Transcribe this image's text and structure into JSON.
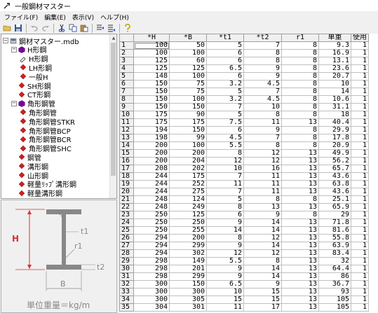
{
  "window": {
    "title": "一般鋼材マスター"
  },
  "menu": [
    "ファイル(F)",
    "編集(E)",
    "表示(V)",
    "ヘルプ(H)"
  ],
  "toolbar_icons": [
    "open-icon",
    "save-icon",
    "undo-icon",
    "redo-icon",
    "cut-icon",
    "copy-icon",
    "paste-icon",
    "insert-row-icon",
    "append-row-icon",
    "help-icon"
  ],
  "tree": {
    "root": "鋼材マスター.mdb",
    "nodes": [
      {
        "label": "H形鋼",
        "level": 1,
        "expander": "minus",
        "icon": "purple-hex"
      },
      {
        "label": "H形鋼",
        "level": 2,
        "expander": "",
        "icon": "open-pencil"
      },
      {
        "label": "LH形鋼",
        "level": 2,
        "expander": "",
        "icon": "red-diamond"
      },
      {
        "label": "一般H",
        "level": 2,
        "expander": "",
        "icon": "red-diamond"
      },
      {
        "label": "SH形鋼",
        "level": 1,
        "expander": "",
        "icon": "red-diamond"
      },
      {
        "label": "CT形鋼",
        "level": 1,
        "expander": "",
        "icon": "red-diamond"
      },
      {
        "label": "角形鋼管",
        "level": 1,
        "expander": "minus",
        "icon": "purple-hex"
      },
      {
        "label": "角形鋼管",
        "level": 2,
        "expander": "",
        "icon": "red-diamond"
      },
      {
        "label": "角形鋼管STKR",
        "level": 2,
        "expander": "",
        "icon": "red-diamond"
      },
      {
        "label": "角形鋼管BCP",
        "level": 2,
        "expander": "",
        "icon": "red-diamond"
      },
      {
        "label": "角形鋼管BCR",
        "level": 2,
        "expander": "",
        "icon": "red-diamond"
      },
      {
        "label": "角形鋼管SHC",
        "level": 2,
        "expander": "",
        "icon": "red-diamond"
      },
      {
        "label": "鋼管",
        "level": 1,
        "expander": "",
        "icon": "red-diamond"
      },
      {
        "label": "溝形鋼",
        "level": 1,
        "expander": "",
        "icon": "red-diamond"
      },
      {
        "label": "山形鋼",
        "level": 1,
        "expander": "",
        "icon": "red-diamond"
      },
      {
        "label": "軽量ﾘｯﾌﾟ溝形鋼",
        "level": 1,
        "expander": "",
        "icon": "red-diamond"
      },
      {
        "label": "軽量溝形鋼",
        "level": 1,
        "expander": "",
        "icon": "red-diamond"
      },
      {
        "label": "平鋼",
        "level": 1,
        "expander": "",
        "icon": "red-diamond"
      }
    ]
  },
  "diagram": {
    "H": "H",
    "B": "B",
    "t1": "t1",
    "t2": "t2",
    "r1": "r1",
    "caption": "単位重量＝kg/m"
  },
  "colors": {
    "dim_red": "#e03030",
    "section_gray": "#888888",
    "hex_purple": "#8000a0",
    "diamond_red": "#cc2020"
  },
  "grid": {
    "columns": [
      "",
      "*H",
      "*B",
      "*t1",
      "*t2",
      "r1",
      "単重",
      "使用"
    ],
    "rows": [
      [
        "1",
        "100",
        "50",
        "5",
        "7",
        "8",
        "9.3",
        "1"
      ],
      [
        "2",
        "100",
        "100",
        "6",
        "8",
        "8",
        "16.9",
        "1"
      ],
      [
        "3",
        "125",
        "60",
        "6",
        "8",
        "8",
        "13.1",
        "1"
      ],
      [
        "4",
        "125",
        "125",
        "6.5",
        "9",
        "8",
        "23.6",
        "1"
      ],
      [
        "5",
        "148",
        "100",
        "6",
        "9",
        "8",
        "20.7",
        "1"
      ],
      [
        "6",
        "150",
        "75",
        "3.2",
        "4.5",
        "8",
        "10",
        "1"
      ],
      [
        "7",
        "150",
        "75",
        "5",
        "7",
        "8",
        "14",
        "1"
      ],
      [
        "8",
        "150",
        "100",
        "3.2",
        "4.5",
        "8",
        "10.6",
        "1"
      ],
      [
        "9",
        "150",
        "150",
        "7",
        "10",
        "8",
        "31.1",
        "1"
      ],
      [
        "10",
        "175",
        "90",
        "5",
        "8",
        "8",
        "18",
        "1"
      ],
      [
        "11",
        "175",
        "175",
        "7.5",
        "11",
        "13",
        "40.4",
        "1"
      ],
      [
        "12",
        "194",
        "150",
        "6",
        "9",
        "8",
        "29.9",
        "1"
      ],
      [
        "13",
        "198",
        "99",
        "4.5",
        "7",
        "8",
        "17.8",
        "1"
      ],
      [
        "14",
        "200",
        "100",
        "5.5",
        "8",
        "8",
        "20.9",
        "1"
      ],
      [
        "15",
        "200",
        "200",
        "8",
        "12",
        "13",
        "49.9",
        "1"
      ],
      [
        "16",
        "200",
        "204",
        "12",
        "12",
        "13",
        "56.2",
        "1"
      ],
      [
        "17",
        "208",
        "202",
        "10",
        "16",
        "13",
        "65.7",
        "1"
      ],
      [
        "18",
        "244",
        "175",
        "7",
        "11",
        "13",
        "43.6",
        "1"
      ],
      [
        "19",
        "244",
        "252",
        "11",
        "11",
        "13",
        "63.8",
        "1"
      ],
      [
        "20",
        "244",
        "275",
        "7",
        "11",
        "13",
        "43.6",
        "1"
      ],
      [
        "21",
        "248",
        "124",
        "5",
        "8",
        "8",
        "25.1",
        "1"
      ],
      [
        "22",
        "248",
        "249",
        "8",
        "13",
        "13",
        "65.9",
        "1"
      ],
      [
        "23",
        "250",
        "125",
        "6",
        "9",
        "8",
        "29",
        "1"
      ],
      [
        "24",
        "250",
        "250",
        "9",
        "14",
        "13",
        "71.8",
        "1"
      ],
      [
        "25",
        "250",
        "255",
        "14",
        "14",
        "13",
        "81.6",
        "1"
      ],
      [
        "26",
        "294",
        "200",
        "8",
        "12",
        "13",
        "55.8",
        "1"
      ],
      [
        "27",
        "294",
        "299",
        "9",
        "14",
        "13",
        "63.9",
        "1"
      ],
      [
        "28",
        "294",
        "302",
        "12",
        "12",
        "13",
        "83.4",
        "1"
      ],
      [
        "29",
        "298",
        "149",
        "5.5",
        "8",
        "13",
        "32",
        "1"
      ],
      [
        "30",
        "298",
        "201",
        "9",
        "14",
        "13",
        "64.4",
        "1"
      ],
      [
        "31",
        "298",
        "299",
        "9",
        "14",
        "13",
        "86",
        "1"
      ],
      [
        "32",
        "300",
        "150",
        "6.5",
        "9",
        "13",
        "36.7",
        "1"
      ],
      [
        "33",
        "300",
        "300",
        "10",
        "15",
        "13",
        "93",
        "1"
      ],
      [
        "34",
        "300",
        "305",
        "15",
        "15",
        "13",
        "105",
        "1"
      ],
      [
        "35",
        "304",
        "301",
        "11",
        "17",
        "13",
        "105",
        "1"
      ]
    ]
  }
}
